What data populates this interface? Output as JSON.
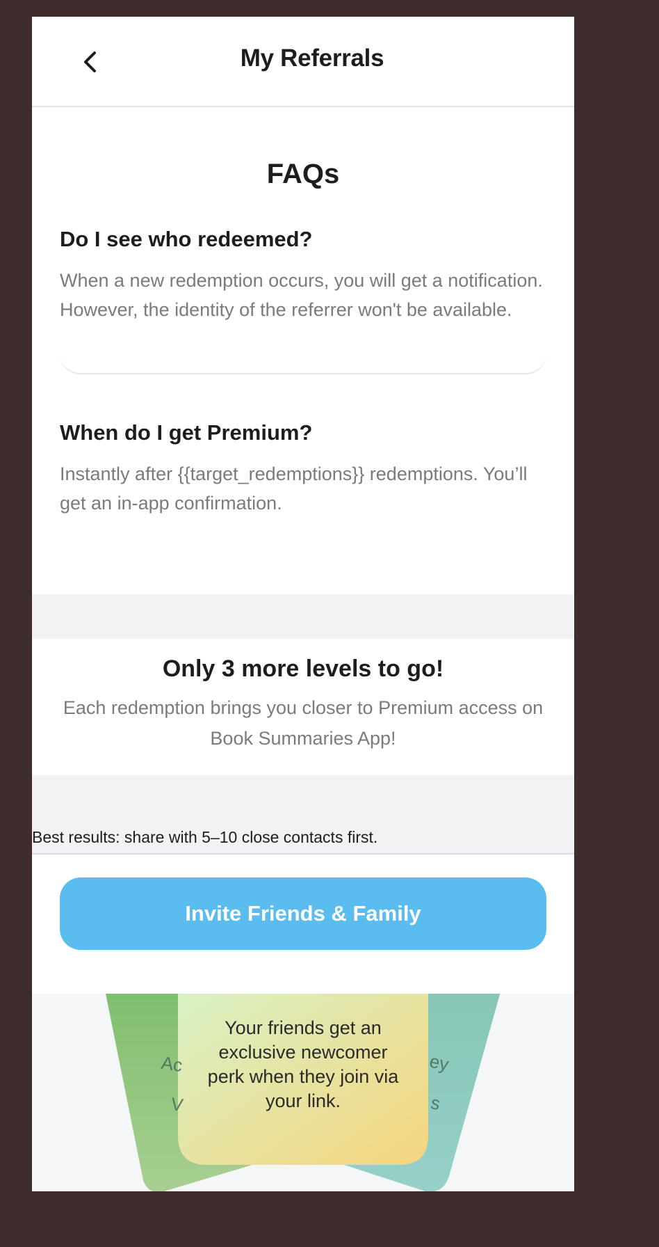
{
  "header": {
    "title": "My Referrals",
    "back_icon": "chevron-left-icon"
  },
  "faq": {
    "title": "FAQs",
    "items": [
      {
        "question": "Do I see who redeemed?",
        "answer": "When a new redemption occurs, you will get a notification. However, the identity of the referrer won't be available."
      },
      {
        "question": "When do I get Premium?",
        "answer": "Instantly after {{target_redemptions}} redemptions. You’ll get an in-app confirmation."
      }
    ]
  },
  "levels": {
    "title": "Only 3 more levels to go!",
    "subtitle": "Each redemption brings you closer to Premium access on Book Summaries App!"
  },
  "tip": "Best results: share with 5–10 close contacts first.",
  "invite_button": "Invite Friends & Family",
  "illustration": {
    "center_card_text": "Your friends get an exclusive newcomer perk when they join via your link.",
    "left_card_peek_1": "Ac",
    "left_card_peek_2": "V",
    "right_card_peek_1": "ey",
    "right_card_peek_2": "s",
    "colors": {
      "left_card": "#7fbe6e",
      "right_card": "#8ccbc0",
      "center_card_top": "#d8f2c6",
      "center_card_bottom": "#f5d57e"
    }
  },
  "colors": {
    "accent": "#5bbcf0",
    "background_frame": "#3f2d2d",
    "muted_text": "#7a7a80"
  }
}
